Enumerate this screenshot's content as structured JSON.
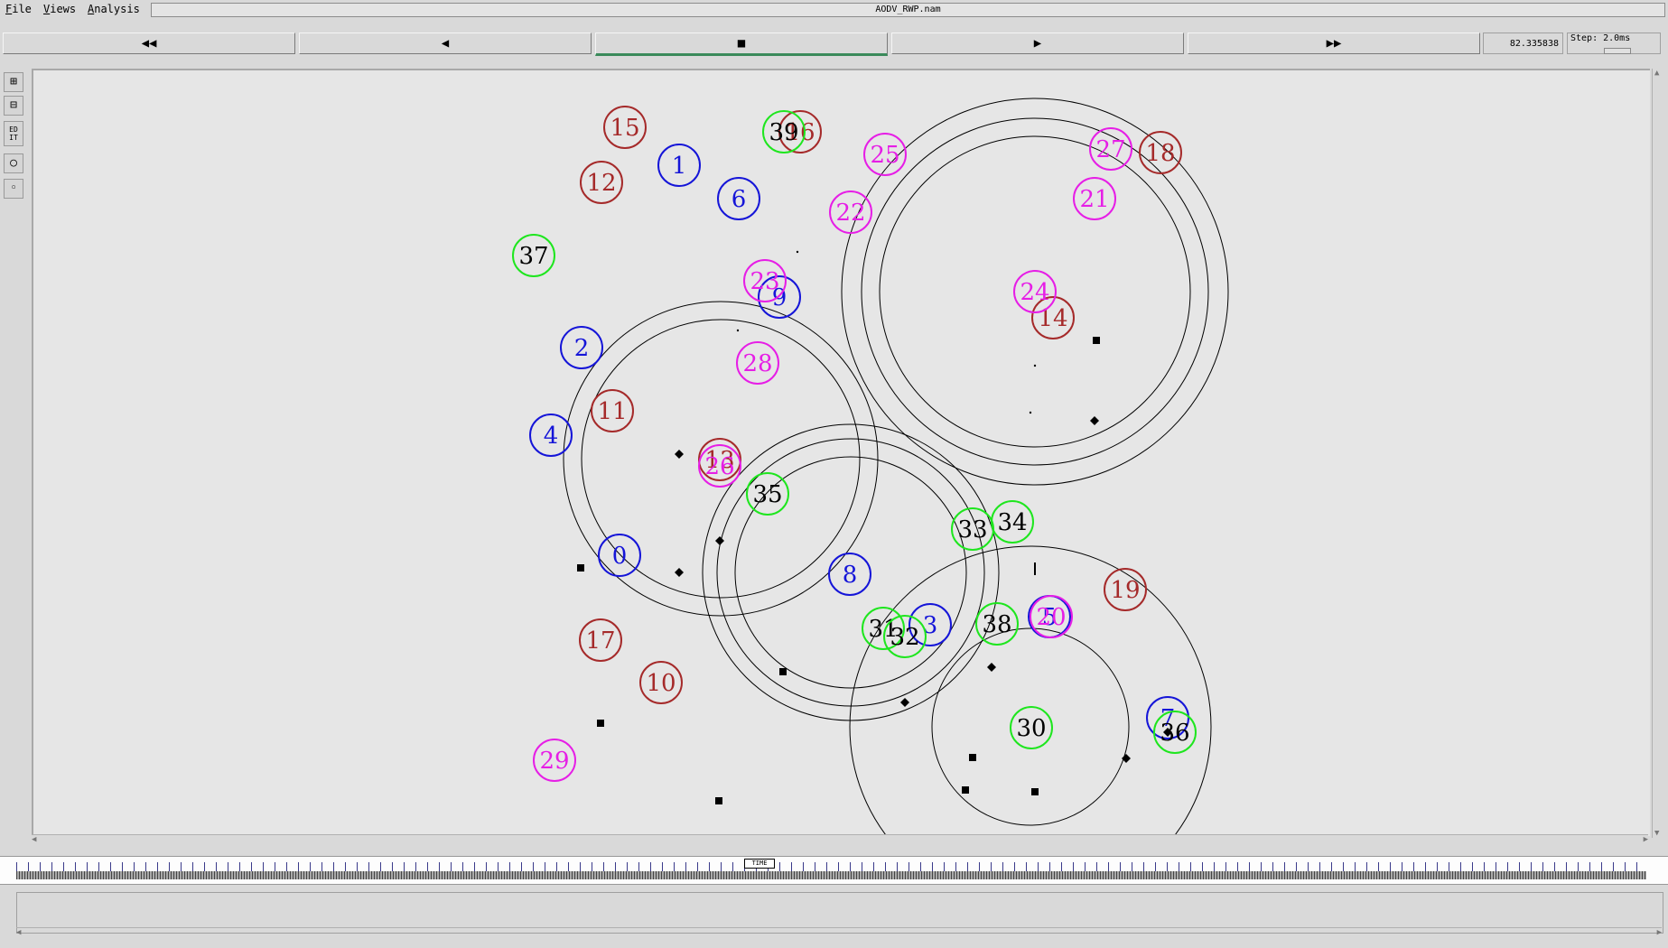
{
  "menu": {
    "file": {
      "accel": "F",
      "rest": "ile"
    },
    "views": {
      "accel": "V",
      "rest": "iews"
    },
    "analysis": {
      "accel": "A",
      "rest": "nalysis"
    }
  },
  "window": {
    "filename": "AODV_RWP.nam"
  },
  "playback": {
    "rewind_glyph": "◀◀",
    "back_glyph": "◀",
    "stop_glyph": "■",
    "play_glyph": "▶",
    "ffwd_glyph": "▶▶",
    "active": "stop"
  },
  "time_display": "82.335838",
  "step_display": "Step: 2.0ms",
  "tools": [
    {
      "name": "zoom-in-tool",
      "glyph": "⊞"
    },
    {
      "name": "zoom-out-tool",
      "glyph": "⊟"
    },
    {
      "name": "edit-tool",
      "glyph": "ED IT"
    },
    {
      "name": "circle-tool-large",
      "glyph": "○"
    },
    {
      "name": "circle-tool-small",
      "glyph": "◦"
    }
  ],
  "timeline_marker": "TIME",
  "colors": {
    "blue": "#1515d8",
    "red": "#a52a2a",
    "magenta": "#e61ee6",
    "green": "#1ee61e",
    "canvas_bg": "#e6e6e6",
    "range_ring": "#000000"
  },
  "nodes": [
    {
      "id": "0",
      "color": "blue"
    },
    {
      "id": "1",
      "color": "blue"
    },
    {
      "id": "2",
      "color": "blue"
    },
    {
      "id": "3",
      "color": "blue"
    },
    {
      "id": "4",
      "color": "blue"
    },
    {
      "id": "5",
      "color": "blue"
    },
    {
      "id": "6",
      "color": "blue"
    },
    {
      "id": "7",
      "color": "blue"
    },
    {
      "id": "8",
      "color": "blue"
    },
    {
      "id": "9",
      "color": "blue"
    },
    {
      "id": "10",
      "color": "red"
    },
    {
      "id": "11",
      "color": "red"
    },
    {
      "id": "12",
      "color": "red"
    },
    {
      "id": "13",
      "color": "red"
    },
    {
      "id": "14",
      "color": "red"
    },
    {
      "id": "15",
      "color": "red"
    },
    {
      "id": "16",
      "color": "red"
    },
    {
      "id": "17",
      "color": "red"
    },
    {
      "id": "18",
      "color": "red"
    },
    {
      "id": "19",
      "color": "red"
    },
    {
      "id": "20",
      "color": "magenta"
    },
    {
      "id": "21",
      "color": "magenta"
    },
    {
      "id": "22",
      "color": "magenta"
    },
    {
      "id": "23",
      "color": "magenta"
    },
    {
      "id": "24",
      "color": "magenta"
    },
    {
      "id": "25",
      "color": "magenta"
    },
    {
      "id": "26",
      "color": "magenta"
    },
    {
      "id": "27",
      "color": "magenta"
    },
    {
      "id": "28",
      "color": "magenta"
    },
    {
      "id": "29",
      "color": "magenta"
    },
    {
      "id": "30",
      "color": "green"
    },
    {
      "id": "31",
      "color": "green"
    },
    {
      "id": "32",
      "color": "green"
    },
    {
      "id": "33",
      "color": "green"
    },
    {
      "id": "34",
      "color": "green"
    },
    {
      "id": "35",
      "color": "green"
    },
    {
      "id": "36",
      "color": "green"
    },
    {
      "id": "37",
      "color": "green"
    },
    {
      "id": "38",
      "color": "green"
    },
    {
      "id": "39",
      "color": "green"
    }
  ]
}
